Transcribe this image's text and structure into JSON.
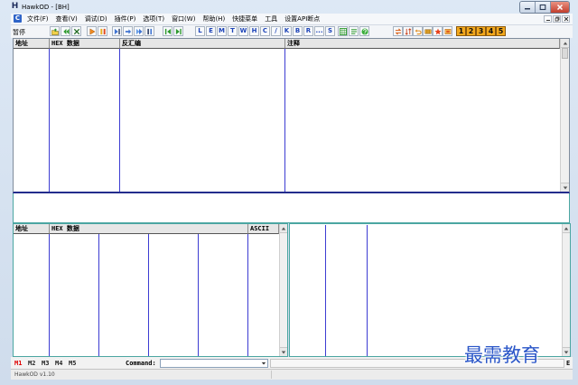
{
  "window": {
    "app_icon_letter": "H",
    "title": "HawkOD - [BH]"
  },
  "menu": {
    "child_icon_letter": "C",
    "items": [
      "文件(F)",
      "查看(V)",
      "调试(D)",
      "插件(P)",
      "选项(T)",
      "窗口(W)",
      "帮助(H)",
      "快捷菜单",
      "工具",
      "设置API断点"
    ]
  },
  "toolbar": {
    "status": "暂停",
    "file_icons": [
      "open-icon",
      "restart-icon",
      "close-icon"
    ],
    "run_icons": [
      "run-icon",
      "pause-icon"
    ],
    "step_icons": [
      "step-into-icon",
      "step-over-icon",
      "trace-into-icon",
      "trace-over-icon"
    ],
    "nav_icons": [
      "execute-till-return-icon",
      "goto-icon"
    ],
    "window_buttons": [
      "L",
      "E",
      "M",
      "T",
      "W",
      "H",
      "C",
      "/",
      "K",
      "B",
      "R",
      "...",
      "S"
    ],
    "misc_icons": [
      "grid-icon",
      "list-icon",
      "help-icon"
    ],
    "tool_icons": [
      "swap-icon",
      "sort-icon",
      "undo-icon",
      "memory-icon",
      "star-icon",
      "patch-icon"
    ],
    "number_buttons": [
      "1",
      "2",
      "3",
      "4",
      "5"
    ]
  },
  "cpu_pane": {
    "columns": [
      "地址",
      "HEX 数据",
      "反汇编",
      "注释"
    ]
  },
  "dump_pane": {
    "columns": [
      "地址",
      "HEX 数据",
      "ASCII"
    ]
  },
  "command_bar": {
    "tabs": [
      "M1",
      "M2",
      "M3",
      "M4",
      "M5"
    ],
    "active_tab_index": 0,
    "command_label": "Command:",
    "command_value": "",
    "right_label": "E"
  },
  "status_bar": {
    "text": "HawkOD v1.10"
  },
  "watermark": "最需教育",
  "colors": {
    "column_line": "#3c3cd2",
    "pane_border": "#4ba6a2",
    "cpu_bottom": "#232c8c",
    "active_tab": "#e00000",
    "watermark": "#2a56c8"
  }
}
